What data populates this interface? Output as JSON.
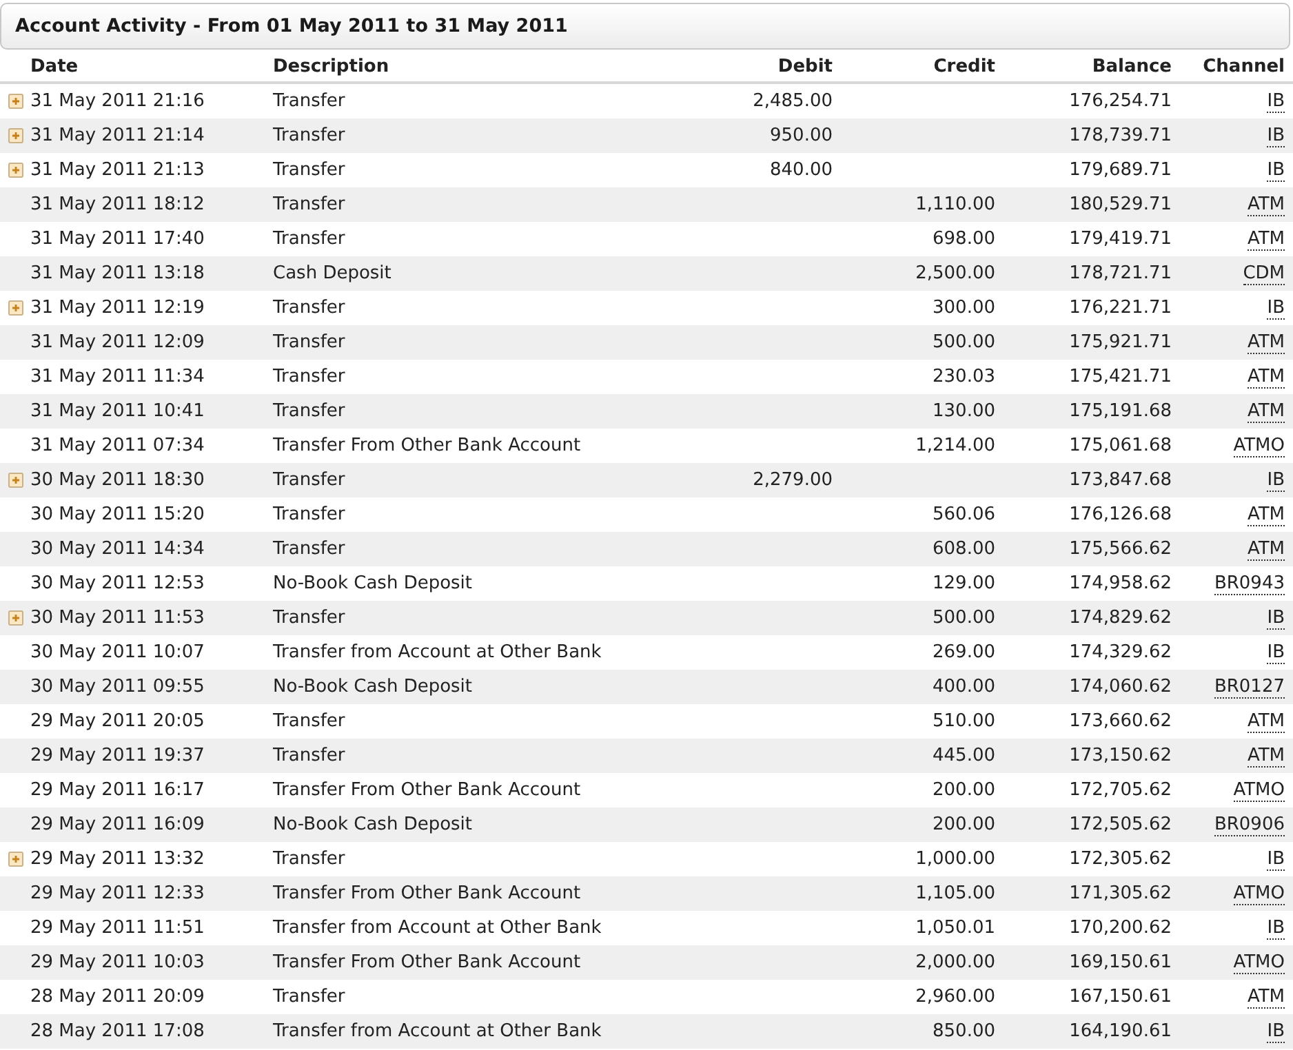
{
  "panel": {
    "title": "Account Activity - From 01 May 2011 to 31 May 2011"
  },
  "table": {
    "columns": [
      "Date",
      "Description",
      "Debit",
      "Credit",
      "Balance",
      "Channel"
    ],
    "rows": [
      {
        "expandable": true,
        "date": "31 May 2011 21:16",
        "description": "Transfer",
        "debit": "2,485.00",
        "credit": "",
        "balance": "176,254.71",
        "channel": "IB"
      },
      {
        "expandable": true,
        "date": "31 May 2011 21:14",
        "description": "Transfer",
        "debit": "950.00",
        "credit": "",
        "balance": "178,739.71",
        "channel": "IB"
      },
      {
        "expandable": true,
        "date": "31 May 2011 21:13",
        "description": "Transfer",
        "debit": "840.00",
        "credit": "",
        "balance": "179,689.71",
        "channel": "IB"
      },
      {
        "expandable": false,
        "date": "31 May 2011 18:12",
        "description": "Transfer",
        "debit": "",
        "credit": "1,110.00",
        "balance": "180,529.71",
        "channel": "ATM"
      },
      {
        "expandable": false,
        "date": "31 May 2011 17:40",
        "description": "Transfer",
        "debit": "",
        "credit": "698.00",
        "balance": "179,419.71",
        "channel": "ATM"
      },
      {
        "expandable": false,
        "date": "31 May 2011 13:18",
        "description": "Cash Deposit",
        "debit": "",
        "credit": "2,500.00",
        "balance": "178,721.71",
        "channel": "CDM"
      },
      {
        "expandable": true,
        "date": "31 May 2011 12:19",
        "description": "Transfer",
        "debit": "",
        "credit": "300.00",
        "balance": "176,221.71",
        "channel": "IB"
      },
      {
        "expandable": false,
        "date": "31 May 2011 12:09",
        "description": "Transfer",
        "debit": "",
        "credit": "500.00",
        "balance": "175,921.71",
        "channel": "ATM"
      },
      {
        "expandable": false,
        "date": "31 May 2011 11:34",
        "description": "Transfer",
        "debit": "",
        "credit": "230.03",
        "balance": "175,421.71",
        "channel": "ATM"
      },
      {
        "expandable": false,
        "date": "31 May 2011 10:41",
        "description": "Transfer",
        "debit": "",
        "credit": "130.00",
        "balance": "175,191.68",
        "channel": "ATM"
      },
      {
        "expandable": false,
        "date": "31 May 2011 07:34",
        "description": "Transfer From Other Bank Account",
        "debit": "",
        "credit": "1,214.00",
        "balance": "175,061.68",
        "channel": "ATMO"
      },
      {
        "expandable": true,
        "date": "30 May 2011 18:30",
        "description": "Transfer",
        "debit": "2,279.00",
        "credit": "",
        "balance": "173,847.68",
        "channel": "IB"
      },
      {
        "expandable": false,
        "date": "30 May 2011 15:20",
        "description": "Transfer",
        "debit": "",
        "credit": "560.06",
        "balance": "176,126.68",
        "channel": "ATM"
      },
      {
        "expandable": false,
        "date": "30 May 2011 14:34",
        "description": "Transfer",
        "debit": "",
        "credit": "608.00",
        "balance": "175,566.62",
        "channel": "ATM"
      },
      {
        "expandable": false,
        "date": "30 May 2011 12:53",
        "description": "No-Book Cash Deposit",
        "debit": "",
        "credit": "129.00",
        "balance": "174,958.62",
        "channel": "BR0943"
      },
      {
        "expandable": true,
        "date": "30 May 2011 11:53",
        "description": "Transfer",
        "debit": "",
        "credit": "500.00",
        "balance": "174,829.62",
        "channel": "IB"
      },
      {
        "expandable": false,
        "date": "30 May 2011 10:07",
        "description": "Transfer from Account at Other Bank",
        "debit": "",
        "credit": "269.00",
        "balance": "174,329.62",
        "channel": "IB"
      },
      {
        "expandable": false,
        "date": "30 May 2011 09:55",
        "description": "No-Book Cash Deposit",
        "debit": "",
        "credit": "400.00",
        "balance": "174,060.62",
        "channel": "BR0127"
      },
      {
        "expandable": false,
        "date": "29 May 2011 20:05",
        "description": "Transfer",
        "debit": "",
        "credit": "510.00",
        "balance": "173,660.62",
        "channel": "ATM"
      },
      {
        "expandable": false,
        "date": "29 May 2011 19:37",
        "description": "Transfer",
        "debit": "",
        "credit": "445.00",
        "balance": "173,150.62",
        "channel": "ATM"
      },
      {
        "expandable": false,
        "date": "29 May 2011 16:17",
        "description": "Transfer From Other Bank Account",
        "debit": "",
        "credit": "200.00",
        "balance": "172,705.62",
        "channel": "ATMO"
      },
      {
        "expandable": false,
        "date": "29 May 2011 16:09",
        "description": "No-Book Cash Deposit",
        "debit": "",
        "credit": "200.00",
        "balance": "172,505.62",
        "channel": "BR0906"
      },
      {
        "expandable": true,
        "date": "29 May 2011 13:32",
        "description": "Transfer",
        "debit": "",
        "credit": "1,000.00",
        "balance": "172,305.62",
        "channel": "IB"
      },
      {
        "expandable": false,
        "date": "29 May 2011 12:33",
        "description": "Transfer From Other Bank Account",
        "debit": "",
        "credit": "1,105.00",
        "balance": "171,305.62",
        "channel": "ATMO"
      },
      {
        "expandable": false,
        "date": "29 May 2011 11:51",
        "description": "Transfer from Account at Other Bank",
        "debit": "",
        "credit": "1,050.01",
        "balance": "170,200.62",
        "channel": "IB"
      },
      {
        "expandable": false,
        "date": "29 May 2011 10:03",
        "description": "Transfer From Other Bank Account",
        "debit": "",
        "credit": "2,000.00",
        "balance": "169,150.61",
        "channel": "ATMO"
      },
      {
        "expandable": false,
        "date": "28 May 2011 20:09",
        "description": "Transfer",
        "debit": "",
        "credit": "2,960.00",
        "balance": "167,150.61",
        "channel": "ATM"
      },
      {
        "expandable": false,
        "date": "28 May 2011 17:08",
        "description": "Transfer from Account at Other Bank",
        "debit": "",
        "credit": "850.00",
        "balance": "164,190.61",
        "channel": "IB"
      }
    ]
  }
}
